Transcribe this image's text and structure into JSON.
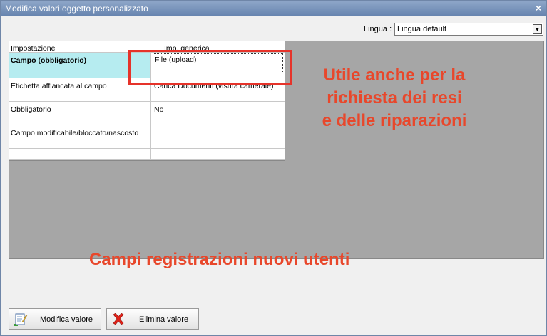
{
  "window": {
    "title": "Modifica valori oggetto personalizzato",
    "close": "×"
  },
  "language": {
    "label": "Lingua :",
    "value": "Lingua default"
  },
  "grid": {
    "headers": [
      "Impostazione",
      "Imp. generica"
    ],
    "rows": [
      {
        "key": "Campo (obbligatorio)",
        "value": "File (upload)"
      },
      {
        "key": "Etichetta affiancata al campo",
        "value": "Carica Documenti (visura camerale)"
      },
      {
        "key": "Obbligatorio",
        "value": "No"
      },
      {
        "key": "Campo modificabile/bloccato/nascosto",
        "value": ""
      },
      {
        "key": "",
        "value": ""
      }
    ]
  },
  "annotations": {
    "note1": [
      "Utile anche per la",
      "richiesta dei resi",
      "e delle riparazioni"
    ],
    "note2": "Campi registrazioni nuovi utenti",
    "accent_color": "#e8472b"
  },
  "buttons": {
    "edit": {
      "label": "Modifica valore",
      "icon": "edit-document-icon"
    },
    "delete": {
      "label": "Elimina valore",
      "icon": "red-x-icon"
    }
  }
}
